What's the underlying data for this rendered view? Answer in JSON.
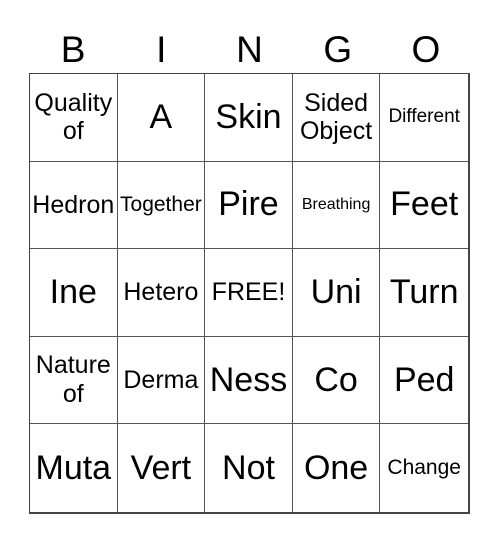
{
  "header": [
    "B",
    "I",
    "N",
    "G",
    "O"
  ],
  "board": [
    [
      {
        "text": "Quality of",
        "size": "l"
      },
      {
        "text": "A",
        "size": "xl"
      },
      {
        "text": "Skin",
        "size": "xl"
      },
      {
        "text": "Sided Object",
        "size": "l"
      },
      {
        "text": "Different",
        "size": "s"
      }
    ],
    [
      {
        "text": "Hedron",
        "size": "l"
      },
      {
        "text": "Together",
        "size": "m"
      },
      {
        "text": "Pire",
        "size": "xl"
      },
      {
        "text": "Breathing",
        "size": "xs"
      },
      {
        "text": "Feet",
        "size": "xl"
      }
    ],
    [
      {
        "text": "Ine",
        "size": "xl"
      },
      {
        "text": "Hetero",
        "size": "l"
      },
      {
        "text": "FREE!",
        "size": "l"
      },
      {
        "text": "Uni",
        "size": "xl"
      },
      {
        "text": "Turn",
        "size": "xl"
      }
    ],
    [
      {
        "text": "Nature of",
        "size": "l"
      },
      {
        "text": "Derma",
        "size": "l"
      },
      {
        "text": "Ness",
        "size": "xl"
      },
      {
        "text": "Co",
        "size": "xl"
      },
      {
        "text": "Ped",
        "size": "xl"
      }
    ],
    [
      {
        "text": "Muta",
        "size": "xl"
      },
      {
        "text": "Vert",
        "size": "xl"
      },
      {
        "text": "Not",
        "size": "xl"
      },
      {
        "text": "One",
        "size": "xl"
      },
      {
        "text": "Change",
        "size": "m"
      }
    ]
  ]
}
